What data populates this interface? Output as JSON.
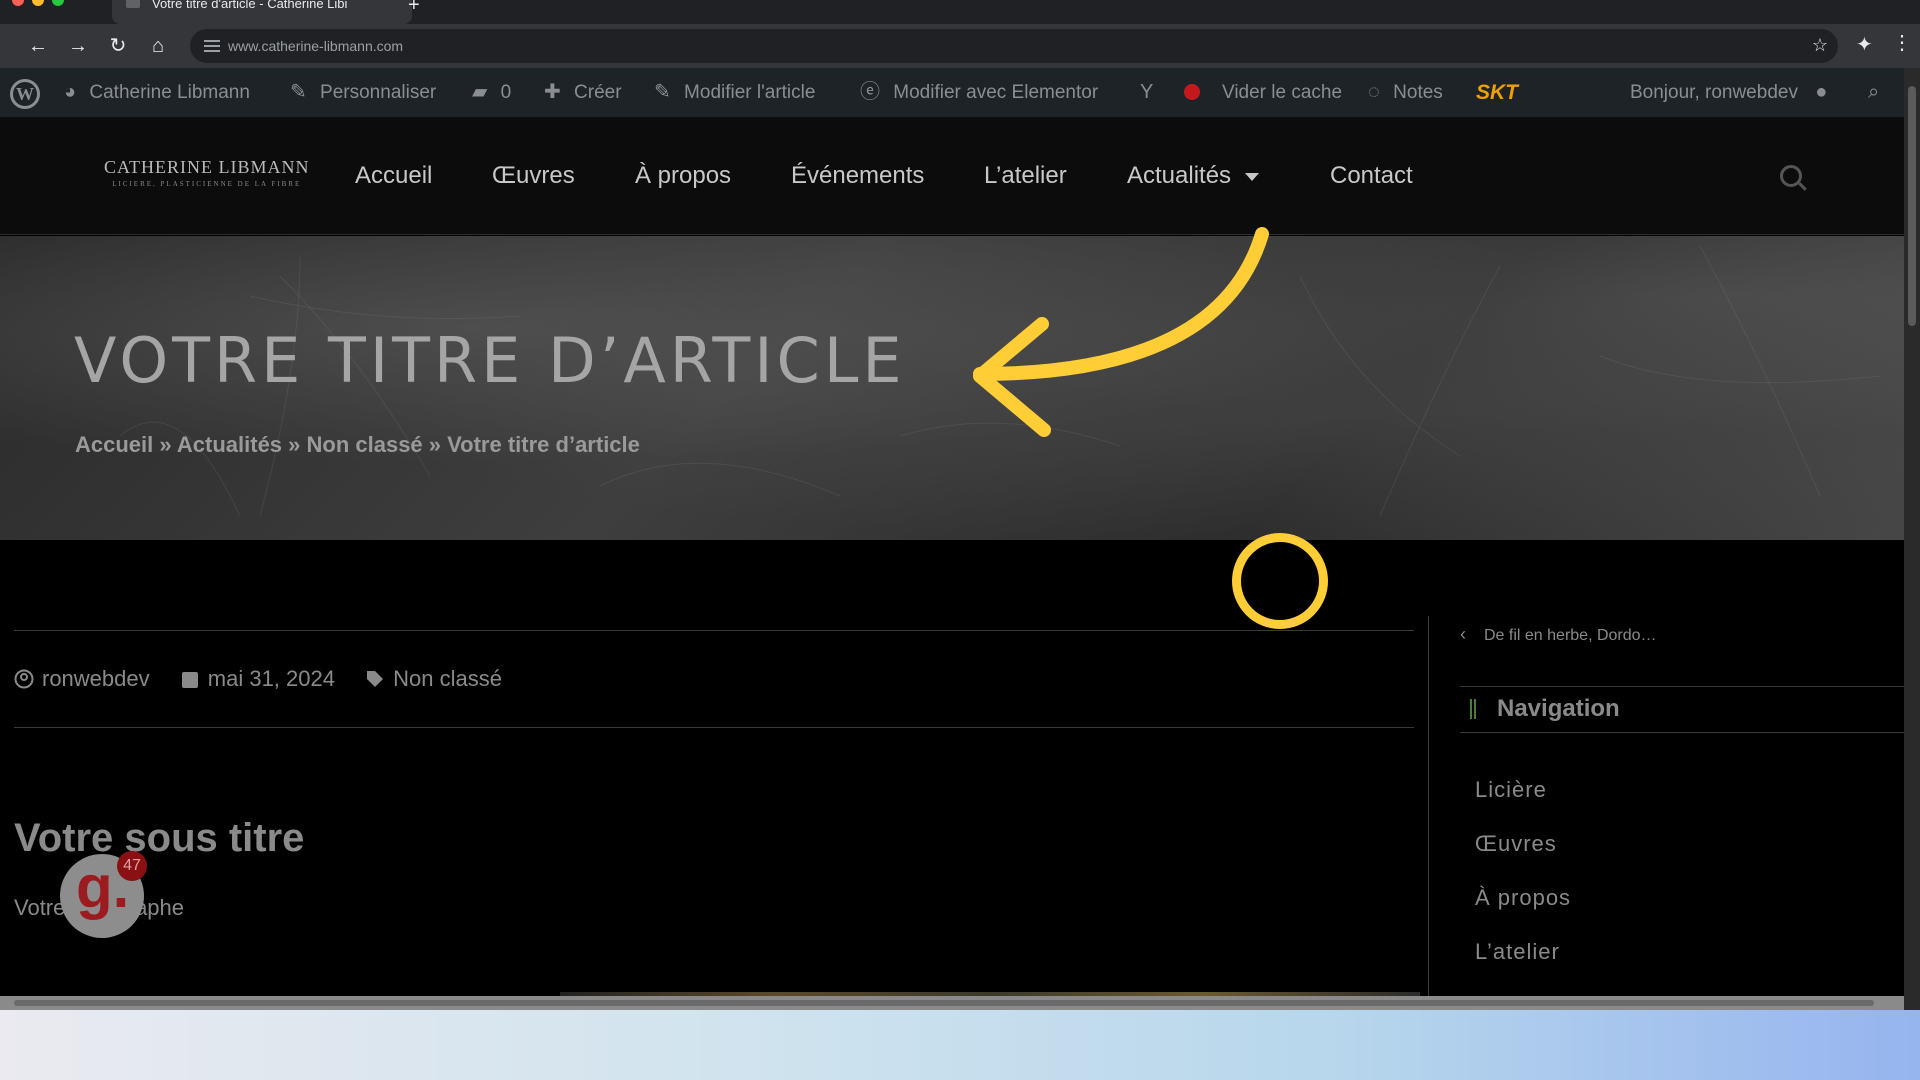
{
  "browser": {
    "tab_title": "Votre titre d'article - Catherine Libi",
    "new_tab": "+",
    "url": "www.catherine-libmann.com",
    "back_icon": "←",
    "forward_icon": "→",
    "reload_icon": "↻",
    "home_icon": "⌂",
    "star_icon": "☆",
    "extensions_icon": "✦",
    "menu_icon": "⋮"
  },
  "admin_bar": {
    "site_name": "Catherine Libmann",
    "customize": "Personnaliser",
    "comments_count": "0",
    "create": "Créer",
    "edit_post": "Modifier l'article",
    "edit_elementor": "Modifier avec Elementor",
    "clear_cache": "Vider le cache",
    "notes": "Notes",
    "skt": "SKT",
    "greeting": "Bonjour, ronwebdev"
  },
  "site": {
    "logo_line1": "CATHERINE LIBMANN",
    "logo_line2": "LICIERE, PLASTICIENNE DE LA FIBRE",
    "nav": [
      "Accueil",
      "Œuvres",
      "À propos",
      "Événements",
      "L’atelier",
      "Actualités",
      "Contact"
    ]
  },
  "hero": {
    "title": "VOTRE TITRE D’ARTICLE",
    "breadcrumb": "Accueil » Actualités » Non classé » Votre titre d’article"
  },
  "post": {
    "author": "ronwebdev",
    "date": "mai 31, 2024",
    "category": "Non classé",
    "subtitle": "Votre sous titre",
    "paragraph": "Votre paragraphe"
  },
  "sidebar": {
    "prev_post": "De fil en herbe, Dordo…",
    "nav_heading": "Navigation",
    "items": [
      "Licière",
      "Œuvres",
      "À propos",
      "L’atelier"
    ]
  },
  "badge": {
    "letter": "g.",
    "count": "47"
  },
  "colors": {
    "annotation": "#ffcd35",
    "adminbar": "#1d2327",
    "badge_red": "#9b1b20"
  }
}
